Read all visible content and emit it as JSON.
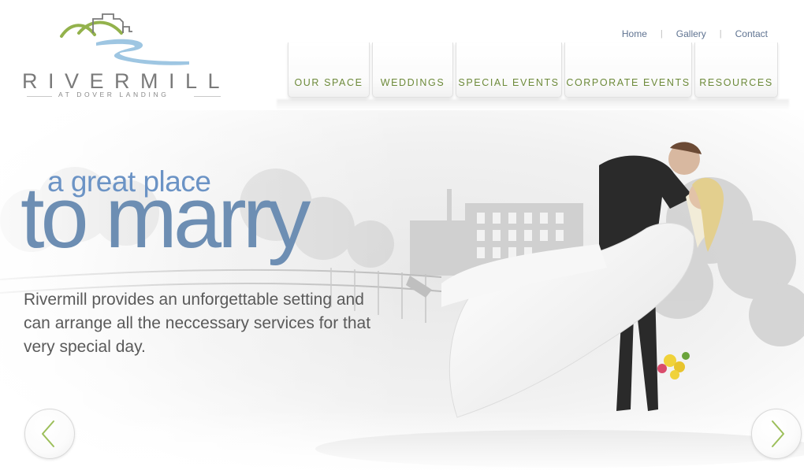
{
  "logo": {
    "wordmark": "RIVERMILL",
    "subtitle": "AT DOVER LANDING",
    "colors": {
      "hills": "#93b24c",
      "river": "#9ec6e2",
      "buildings": "#7a7a7a"
    }
  },
  "utility_nav": {
    "items": [
      {
        "label": "Home"
      },
      {
        "label": "Gallery"
      },
      {
        "label": "Contact"
      }
    ],
    "separator": "|"
  },
  "main_nav": {
    "tabs": [
      {
        "label": "OUR SPACE"
      },
      {
        "label": "WEDDINGS"
      },
      {
        "label": "SPECIAL EVENTS"
      },
      {
        "label": "CORPORATE EVENTS"
      },
      {
        "label": "RESOURCES"
      }
    ]
  },
  "hero": {
    "tagline_small": "a great place",
    "tagline_big": "to marry",
    "description": "Rivermill provides an unforgettable setting and can arrange all the neccessary services for that very special day.",
    "prev_icon": "chevron-left-icon",
    "next_icon": "chevron-right-icon",
    "accent_color": "#9cbf5a",
    "tagline_color": "#6b93c5"
  }
}
